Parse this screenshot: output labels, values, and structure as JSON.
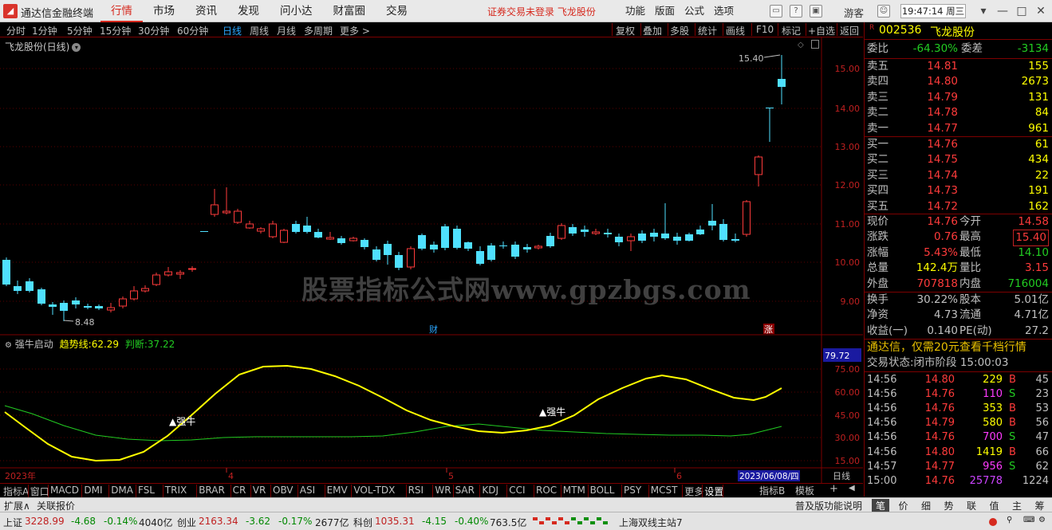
{
  "app": {
    "logo": "◢",
    "name": "通达信金融终端"
  },
  "menu": [
    {
      "label": "行情",
      "active": true
    },
    {
      "label": "市场"
    },
    {
      "label": "资讯"
    },
    {
      "label": "发现"
    },
    {
      "label": "问小达"
    },
    {
      "label": "财富圈"
    },
    {
      "label": "交易"
    }
  ],
  "notice": "证券交易未登录  飞龙股份",
  "menu_right": [
    "功能",
    "版面",
    "公式",
    "选项"
  ],
  "guest": "游客",
  "clock": "19:47:14 周三",
  "periods": [
    "分时",
    "1分钟",
    "5分钟",
    "15分钟",
    "30分钟",
    "60分钟",
    "日线",
    "周线",
    "月线",
    "多周期",
    "更多 >"
  ],
  "active_period": "日线",
  "tools": [
    "复权",
    "叠加",
    "多股",
    "统计",
    "画线",
    "F10",
    "标记",
    "+自选",
    "返回"
  ],
  "chart": {
    "title": "飞龙股份(日线)",
    "price_ticks": [
      "15.00",
      "14.00",
      "13.00",
      "12.00",
      "11.00",
      "10.00",
      "9.00"
    ],
    "max_label": "15.40",
    "min_label": "8.48",
    "marker_cai": "财",
    "marker_zhang": "涨"
  },
  "indicator": {
    "name": "强牛启动",
    "line1_label": "趋势线:",
    "line1_value": "62.29",
    "line2_label": "判断:",
    "line2_value": "37.22",
    "cur_value": "79.72",
    "ticks": [
      "75.00",
      "60.00",
      "45.00",
      "30.00",
      "15.00"
    ],
    "signal1": "▲强牛",
    "signal2": "▲强牛",
    "colors": {
      "trend": "#ffff00",
      "judge": "#22cc22"
    }
  },
  "x_axis": {
    "labels": [
      "2023年",
      "4",
      "5",
      "6"
    ],
    "cursor_date": "2023/06/08/四",
    "period": "日线"
  },
  "watermark": "股票指标公式网www.gpzbgs.com",
  "quote": {
    "r_badge": "R",
    "code": "002536",
    "name": "飞龙股份",
    "weibi_label": "委比",
    "weibi": "-64.30%",
    "weicha_label": "委差",
    "weicha": "-3134",
    "asks": [
      {
        "label": "卖五",
        "price": "14.81",
        "vol": "155"
      },
      {
        "label": "卖四",
        "price": "14.80",
        "vol": "2673"
      },
      {
        "label": "卖三",
        "price": "14.79",
        "vol": "131"
      },
      {
        "label": "卖二",
        "price": "14.78",
        "vol": "84"
      },
      {
        "label": "卖一",
        "price": "14.77",
        "vol": "961"
      }
    ],
    "bids": [
      {
        "label": "买一",
        "price": "14.76",
        "vol": "61"
      },
      {
        "label": "买二",
        "price": "14.75",
        "vol": "434"
      },
      {
        "label": "买三",
        "price": "14.74",
        "vol": "22"
      },
      {
        "label": "买四",
        "price": "14.73",
        "vol": "191"
      },
      {
        "label": "买五",
        "price": "14.72",
        "vol": "162"
      }
    ],
    "stats": [
      {
        "l1": "现价",
        "v1": "14.76",
        "l2": "今开",
        "v2": "14.58"
      },
      {
        "l1": "涨跌",
        "v1": "0.76",
        "l2": "最高",
        "v2": "15.40"
      },
      {
        "l1": "涨幅",
        "v1": "5.43%",
        "l2": "最低",
        "v2": "14.10"
      },
      {
        "l1": "总量",
        "v1": "142.4万",
        "l2": "量比",
        "v2": "3.15"
      },
      {
        "l1": "外盘",
        "v1": "707818",
        "l2": "内盘",
        "v2": "716004"
      }
    ],
    "stats2": [
      {
        "l1": "换手",
        "v1": "30.22%",
        "l2": "股本",
        "v2": "5.01亿"
      },
      {
        "l1": "净资",
        "v1": "4.73",
        "l2": "流通",
        "v2": "4.71亿"
      },
      {
        "l1": "收益(一)",
        "v1": "0.140",
        "l2": "PE(动)",
        "v2": "27.2"
      }
    ],
    "promo": "通达信，仅需20元查看千档行情",
    "trade_status": "交易状态:闭市阶段 15:00:03",
    "ticks": [
      {
        "t": "14:56",
        "p": "14.80",
        "v": "229",
        "d": "B",
        "n": "45"
      },
      {
        "t": "14:56",
        "p": "14.76",
        "v": "110",
        "d": "S",
        "n": "23"
      },
      {
        "t": "14:56",
        "p": "14.76",
        "v": "353",
        "d": "B",
        "n": "53"
      },
      {
        "t": "14:56",
        "p": "14.79",
        "v": "580",
        "d": "B",
        "n": "56"
      },
      {
        "t": "14:56",
        "p": "14.76",
        "v": "700",
        "d": "S",
        "n": "47"
      },
      {
        "t": "14:56",
        "p": "14.80",
        "v": "1419",
        "d": "B",
        "n": "66"
      },
      {
        "t": "14:57",
        "p": "14.77",
        "v": "956",
        "d": "S",
        "n": "62"
      },
      {
        "t": "15:00",
        "p": "14.76",
        "v": "25778",
        "d": "",
        "n": "1224"
      }
    ]
  },
  "indicator_tabs": [
    "指标A",
    "窗口",
    "MACD",
    "DMI",
    "DMA",
    "FSL",
    "TRIX",
    "BRAR",
    "CR",
    "VR",
    "OBV",
    "ASI",
    "EMV",
    "VOL-TDX",
    "RSI",
    "WR",
    "SAR",
    "KDJ",
    "CCI",
    "ROC",
    "MTM",
    "BOLL",
    "PSY",
    "MCST",
    "更多",
    "设置"
  ],
  "indicator_b": "指标B",
  "template": "模板",
  "bottom_tabs": [
    "扩展∧",
    "关联报价"
  ],
  "bottom_right_label": "普及版功能说明",
  "bottom_right_tabs": [
    "笔",
    "价",
    "细",
    "势",
    "联",
    "值",
    "主",
    "筹"
  ],
  "status": {
    "sh_label": "上证",
    "sh_val": "3228.99",
    "sh_chg": "-4.68",
    "sh_pct": "-0.14%",
    "sh_amt": "4040亿",
    "cy_label": "创业",
    "cy_val": "2163.34",
    "cy_chg": "-3.62",
    "cy_pct": "-0.17%",
    "cy_amt": "2677亿",
    "kc_label": "科创",
    "kc_val": "1035.31",
    "kc_chg": "-4.15",
    "kc_pct": "-0.40%",
    "kc_amt": "763.5亿",
    "server": "上海双线主站7"
  }
}
